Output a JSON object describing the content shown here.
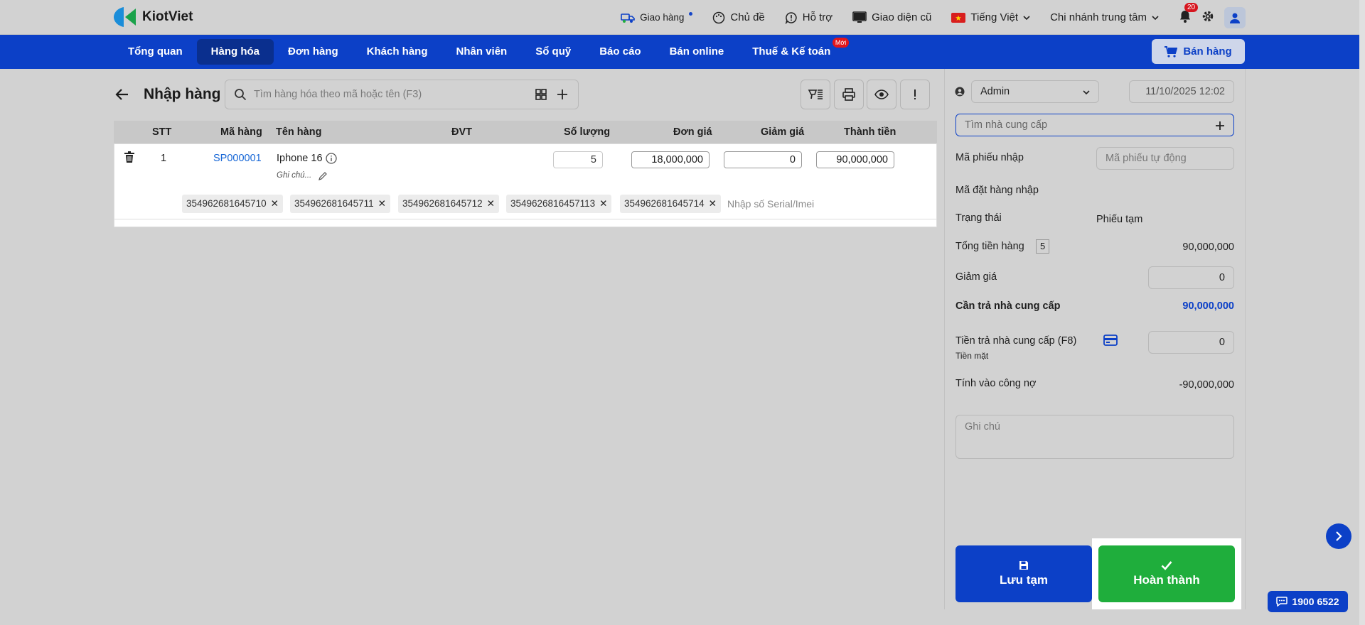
{
  "app": {
    "brand": "KiotViet"
  },
  "topbar": {
    "delivery": "Giao hàng",
    "theme": "Chủ đề",
    "support": "Hỗ trợ",
    "old_ui": "Giao diện cũ",
    "language": "Tiếng Việt",
    "branch": "Chi nhánh trung tâm",
    "notif_count": "20"
  },
  "nav": {
    "items": [
      "Tổng quan",
      "Hàng hóa",
      "Đơn hàng",
      "Khách hàng",
      "Nhân viên",
      "Sổ quỹ",
      "Báo cáo",
      "Bán online",
      "Thuế & Kế toán"
    ],
    "new_tag": "Mới",
    "sell": "Bán hàng",
    "active_index": 1
  },
  "page": {
    "title": "Nhập hàng",
    "search_placeholder": "Tìm hàng hóa theo mã hoặc tên (F3)"
  },
  "table": {
    "headers": {
      "stt": "STT",
      "code": "Mã hàng",
      "name": "Tên hàng",
      "unit": "ĐVT",
      "qty": "Số lượng",
      "price": "Đơn giá",
      "discount": "Giảm giá",
      "total": "Thành tiền"
    },
    "row": {
      "stt": "1",
      "code": "SP000001",
      "name": "Iphone 16",
      "note": "Ghi chú...",
      "qty": "5",
      "price": "18,000,000",
      "discount": "0",
      "total": "90,000,000"
    },
    "serials": [
      "354962681645710",
      "354962681645711",
      "354962681645712",
      "3549626816457113",
      "354962681645714"
    ],
    "serial_placeholder": "Nhập số Serial/Imei"
  },
  "side": {
    "user": "Admin",
    "datetime": "11/10/2025 12:02",
    "supplier_placeholder": "Tìm nhà cung cấp",
    "receipt_code_label": "Mã phiếu nhập",
    "receipt_code_placeholder": "Mã phiếu tự động",
    "order_code_label": "Mã đặt hàng nhập",
    "status_label": "Trạng thái",
    "status_value": "Phiếu tạm",
    "total_label": "Tổng tiền hàng",
    "total_qty": "5",
    "total_value": "90,000,000",
    "discount_label": "Giảm giá",
    "discount_value": "0",
    "payable_label": "Cần trả nhà cung cấp",
    "payable_value": "90,000,000",
    "paid_label": "Tiền trả nhà cung cấp (F8)",
    "paid_method": "Tiền mặt",
    "paid_value": "0",
    "debt_label": "Tính vào công nợ",
    "debt_value": "-90,000,000",
    "note_placeholder": "Ghi chú",
    "save_draft": "Lưu tạm",
    "complete": "Hoàn thành"
  },
  "hotline": "1900 6522",
  "colors": {
    "primary": "#0c40c7",
    "success": "#1fae3c",
    "link": "#1666d6"
  }
}
